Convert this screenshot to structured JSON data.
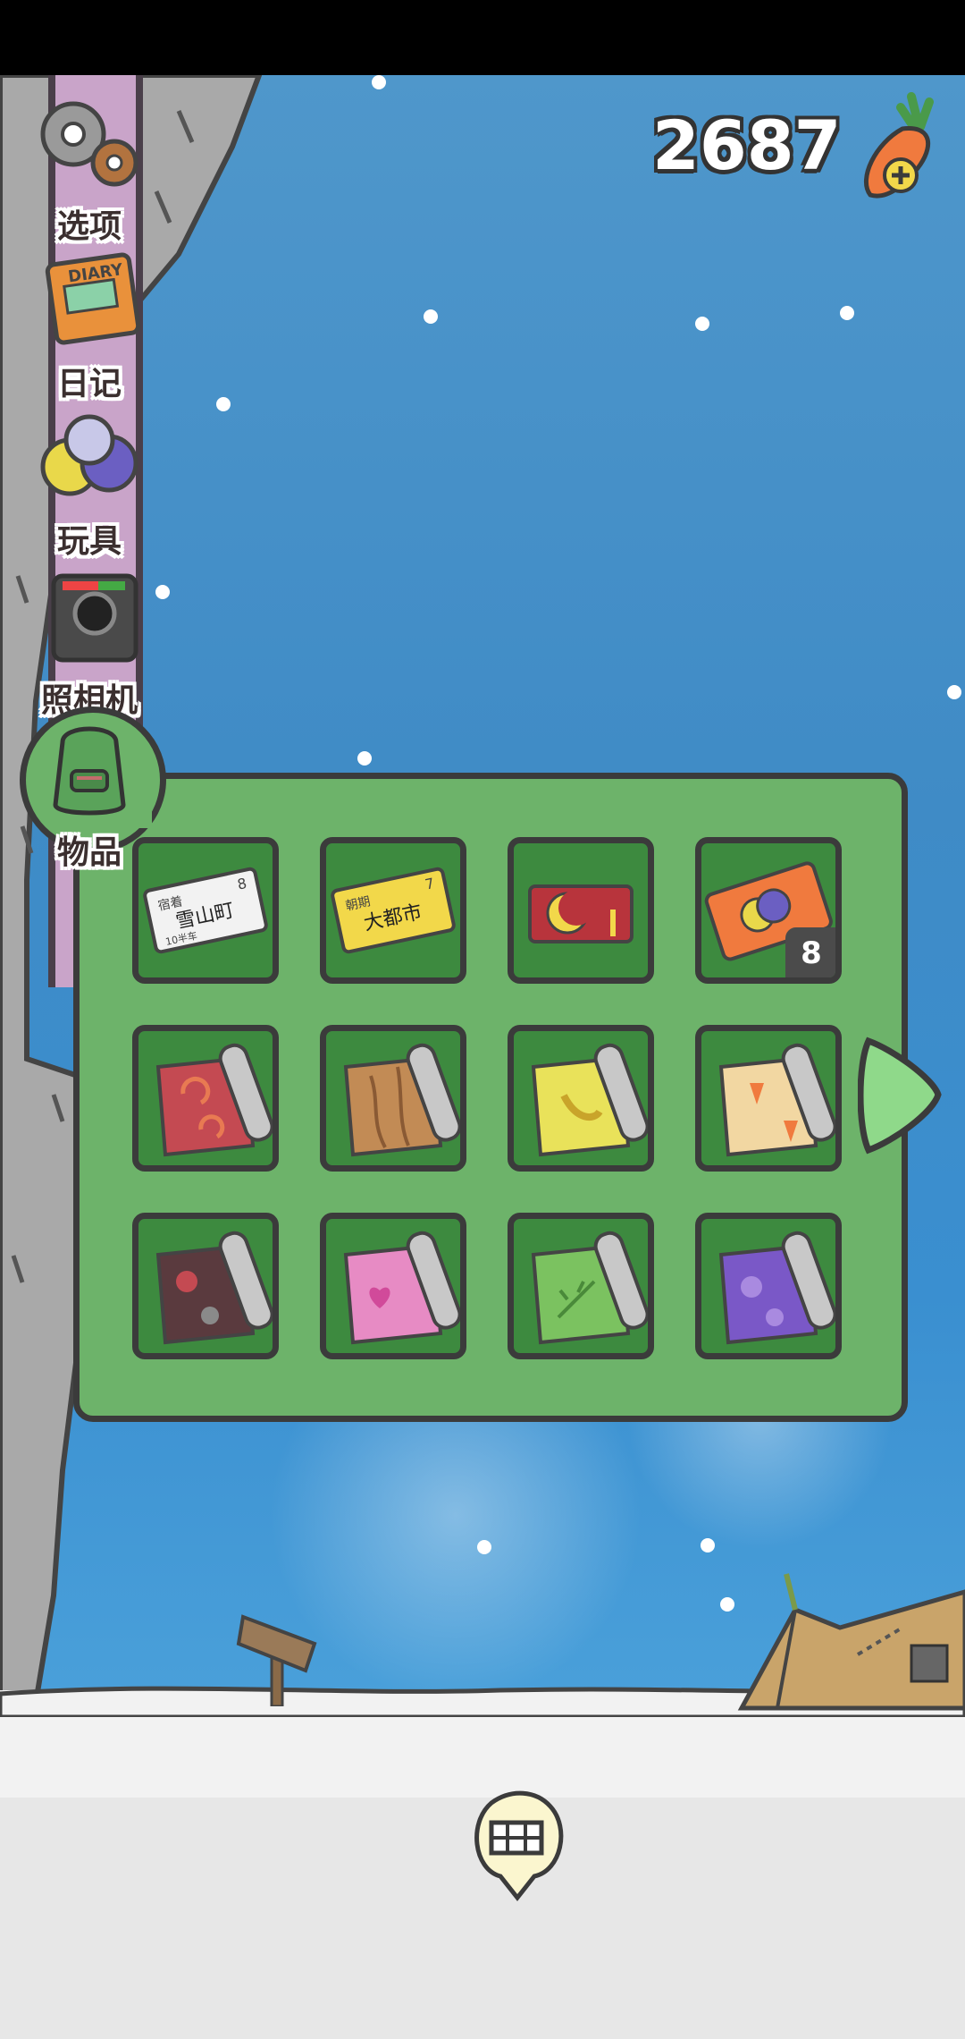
{
  "header": {
    "carrot_count": "2687",
    "carrot_icon": "carrot-plus-icon"
  },
  "sidebar": {
    "items": [
      {
        "label": "选项",
        "icon": "gear-icon"
      },
      {
        "label": "日记",
        "icon": "diary-icon"
      },
      {
        "label": "玩具",
        "icon": "toys-icon"
      },
      {
        "label": "照相机",
        "icon": "camera-icon"
      },
      {
        "label": "物品",
        "icon": "backpack-icon"
      }
    ]
  },
  "inventory": {
    "items": [
      {
        "name": "ticket-snow-town",
        "text_lines": [
          "宿着",
          "雪山町",
          "10半车",
          "8"
        ]
      },
      {
        "name": "ticket-big-city",
        "text_lines": [
          "朝期",
          "大都市",
          "7"
        ]
      },
      {
        "name": "card-red"
      },
      {
        "name": "coupon-orange",
        "count": "8"
      },
      {
        "name": "mat-red-swirl",
        "color": "#c44a52"
      },
      {
        "name": "mat-wood",
        "color": "#c28b55"
      },
      {
        "name": "mat-banana",
        "color": "#e9e25a"
      },
      {
        "name": "mat-carrot",
        "color": "#f2d7a2"
      },
      {
        "name": "mat-sakura-dark",
        "color": "#5a3a3e"
      },
      {
        "name": "mat-pink-heart",
        "color": "#e78bc4"
      },
      {
        "name": "mat-green-leaf",
        "color": "#7bc260"
      },
      {
        "name": "mat-purple-flower",
        "color": "#7a58c7"
      }
    ]
  },
  "colors": {
    "panel": "#6db36a",
    "slot": "#3d8a3f",
    "outline": "#3b3b3b",
    "sky": "#4590c9",
    "pole": "#c9a4c9"
  },
  "bottom": {
    "map_button_icon": "map-icon"
  }
}
